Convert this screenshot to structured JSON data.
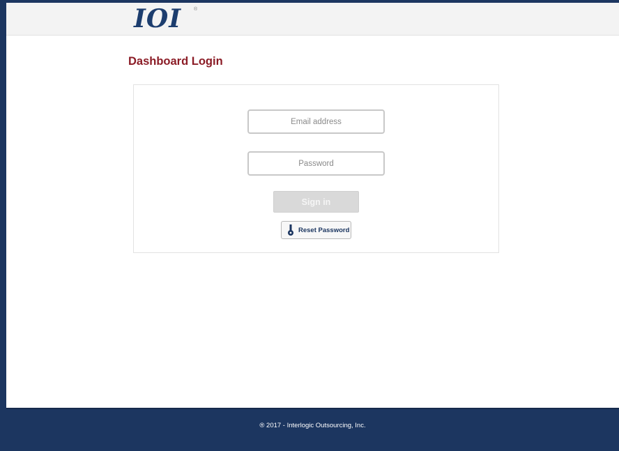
{
  "header": {
    "logo_text": "IOI",
    "logo_trademark": "®"
  },
  "page": {
    "title": "Dashboard Login"
  },
  "login_form": {
    "email_placeholder": "Email address",
    "email_value": "",
    "password_placeholder": "Password",
    "password_value": "",
    "signin_label": "Sign in",
    "reset_label": "Reset Password",
    "reset_icon": "key-icon"
  },
  "footer": {
    "copyright": "® 2017 - Interlogic Outsourcing, Inc."
  },
  "colors": {
    "brand_navy": "#1c3660",
    "title_red": "#8b1c26",
    "button_disabled": "#d9d9d9"
  }
}
